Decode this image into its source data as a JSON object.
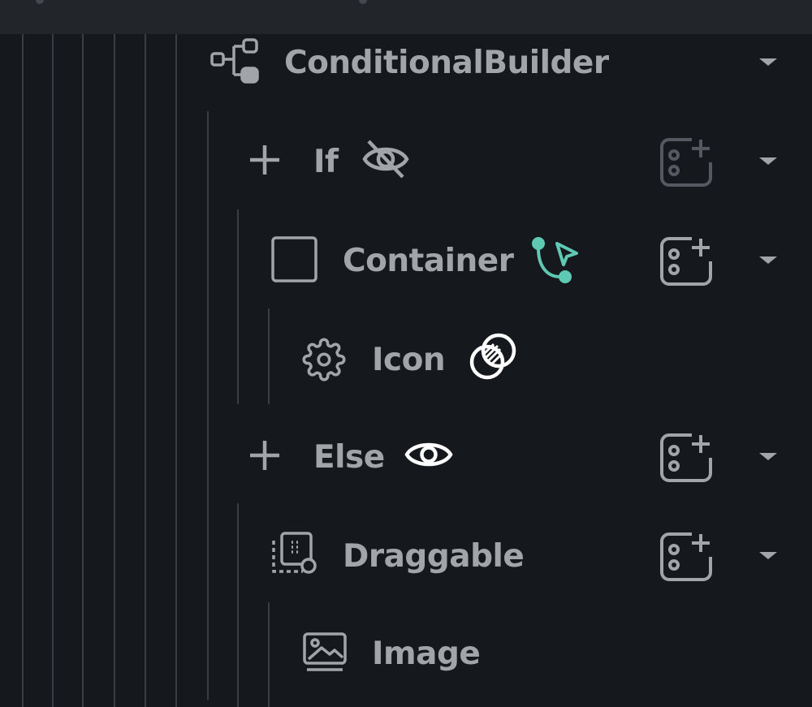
{
  "tree": {
    "root": {
      "label": "ConditionalBuilder",
      "icon": "conditional-builder-icon"
    },
    "if_branch": {
      "label": "If",
      "visibility_icon": "eye-off-icon"
    },
    "container": {
      "label": "Container",
      "flow_icon": "branch-cursor-icon",
      "accent": "#5fc9b3"
    },
    "icon_widget": {
      "label": "Icon",
      "icon": "gear-icon",
      "badge_icon": "overlap-circles-icon"
    },
    "else_branch": {
      "label": "Else",
      "visibility_icon": "eye-icon"
    },
    "draggable": {
      "label": "Draggable",
      "icon": "draggable-icon"
    },
    "image": {
      "label": "Image",
      "icon": "image-icon"
    }
  },
  "colors": {
    "background": "#15181c",
    "text": "#a1a5aa",
    "guide": "#3a3e44",
    "accent": "#5fc9b3"
  }
}
